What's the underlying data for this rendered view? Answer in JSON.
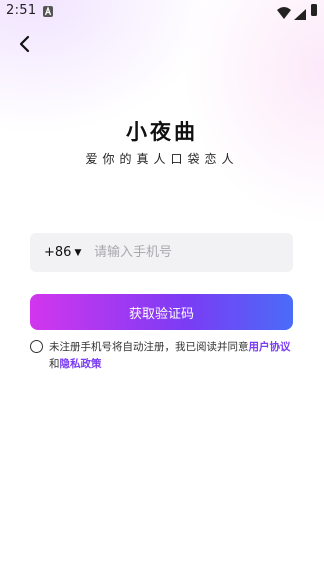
{
  "status_bar": {
    "time": "2:51",
    "icons": [
      "notification-icon",
      "wifi-icon",
      "signal-icon",
      "battery-icon"
    ]
  },
  "nav": {
    "back_icon": "chevron-left-icon"
  },
  "brand": {
    "title": "小夜曲",
    "slogan": "爱你的真人口袋恋人"
  },
  "login": {
    "country_code": "+86",
    "phone_placeholder": "请输入手机号",
    "phone_value": "",
    "submit_label": "获取验证码"
  },
  "agreement": {
    "checked": false,
    "text": "未注册手机号将自动注册，我已阅读并同意",
    "user_agreement": "用户协议",
    "and": "和",
    "privacy_policy": "隐私政策"
  },
  "colors": {
    "accent": "#7a3cf4",
    "button_gradient_start": "#d236ee",
    "button_gradient_end": "#4a6cf8",
    "input_background": "#f2f2f4"
  }
}
